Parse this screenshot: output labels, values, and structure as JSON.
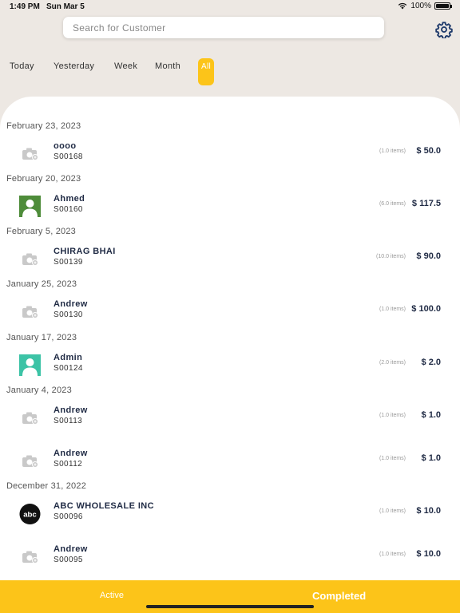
{
  "status_bar": {
    "time": "1:49 PM",
    "date": "Sun Mar 5",
    "battery": "100%"
  },
  "search": {
    "placeholder": "Search for Customer"
  },
  "icons": {
    "settings": "gear-icon",
    "placeholder_photo": "camera-placeholder-icon",
    "user": "person-silhouette-icon"
  },
  "filters": [
    {
      "label": "Today"
    },
    {
      "label": "Yesterday"
    },
    {
      "label": "Week"
    },
    {
      "label": "Month"
    },
    {
      "label": "All",
      "active": true
    }
  ],
  "orders": {
    "dates": [
      "February 23, 2023",
      "February 20, 2023",
      "February 5, 2023",
      "January 25, 2023",
      "January 17, 2023",
      "January 4, 2023",
      "December 31, 2022"
    ],
    "rows": [
      {
        "name": "oooo",
        "id": "S00168",
        "items": "(1.0 items)",
        "amount": "$ 50.0",
        "avatar": "camera"
      },
      {
        "name": "Ahmed",
        "id": "S00160",
        "items": "(6.0 items)",
        "amount": "$ 117.5",
        "avatar": "person-green"
      },
      {
        "name": "CHIRAG BHAI",
        "id": "S00139",
        "items": "(10.0 items)",
        "amount": "$ 90.0",
        "avatar": "camera"
      },
      {
        "name": "Andrew",
        "id": "S00130",
        "items": "(1.0 items)",
        "amount": "$ 100.0",
        "avatar": "camera"
      },
      {
        "name": "Admin",
        "id": "S00124",
        "items": "(2.0 items)",
        "amount": "$ 2.0",
        "avatar": "person-teal"
      },
      {
        "name": "Andrew",
        "id": "S00113",
        "items": "(1.0 items)",
        "amount": "$ 1.0",
        "avatar": "camera"
      },
      {
        "name": "Andrew",
        "id": "S00112",
        "items": "(1.0 items)",
        "amount": "$ 1.0",
        "avatar": "camera"
      },
      {
        "name": "ABC WHOLESALE INC",
        "id": "S00096",
        "items": "(1.0 items)",
        "amount": "$ 10.0",
        "avatar": "abc-logo"
      },
      {
        "name": "Andrew",
        "id": "S00095",
        "items": "(1.0 items)",
        "amount": "$ 10.0",
        "avatar": "camera"
      }
    ]
  },
  "logo_text": "abc",
  "bottom_tabs": {
    "active": "Active",
    "completed": "Completed"
  },
  "colors": {
    "accent": "#fcc419",
    "background": "#ede8e3",
    "name_text": "#1f2a44",
    "green_avatar": "#4e8c3a",
    "teal_avatar": "#3cc3a6"
  }
}
